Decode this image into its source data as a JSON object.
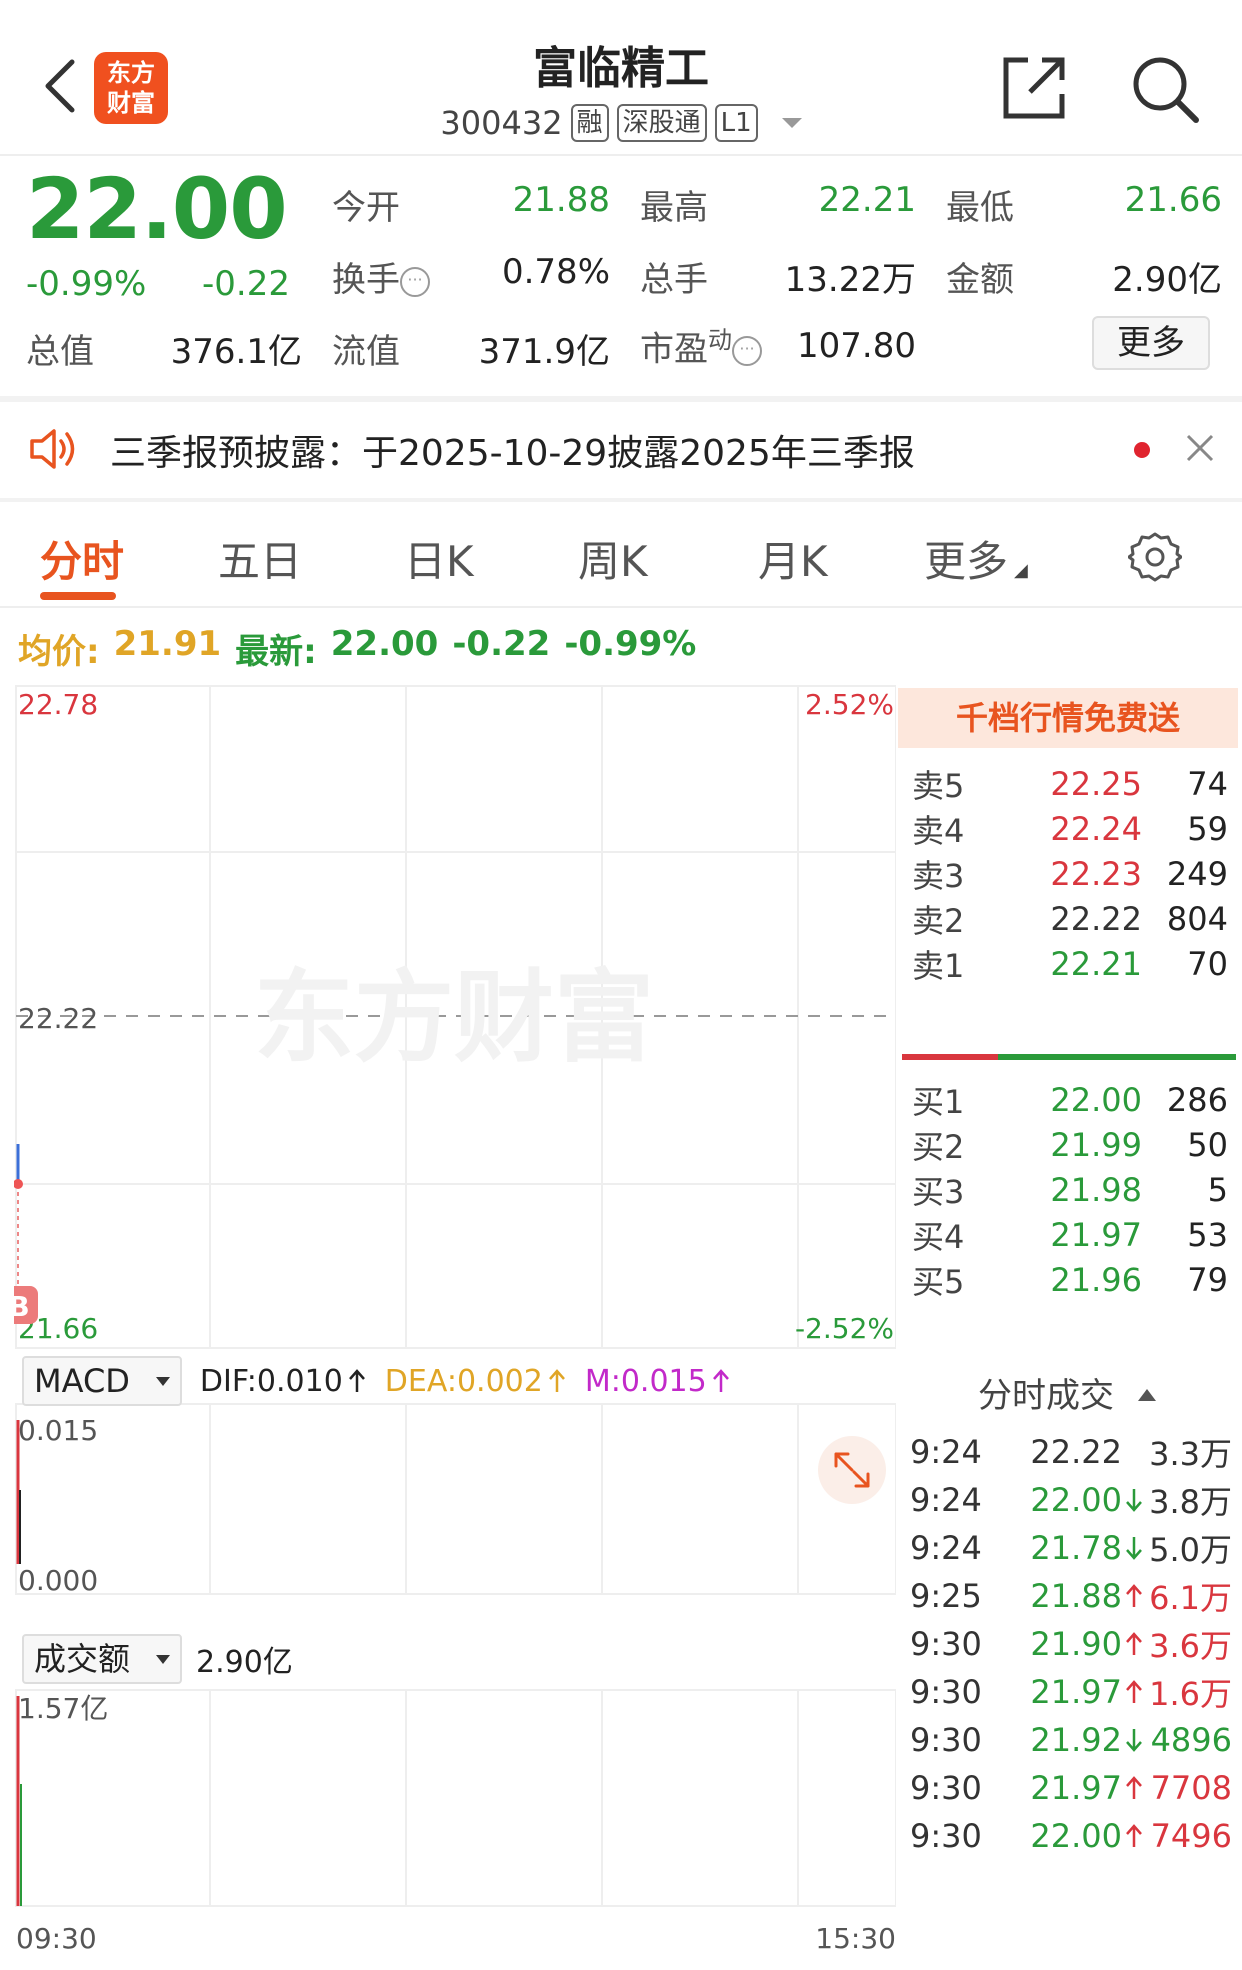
{
  "header": {
    "logo_text_line1": "东方",
    "logo_text_line2": "财富",
    "stock_name": "富临精工",
    "stock_code": "300432",
    "tags": [
      "融",
      "深股通",
      "L1"
    ]
  },
  "quote": {
    "price": "22.00",
    "change_pct": "-0.99%",
    "change": "-0.22",
    "fields": {
      "open_label": "今开",
      "open": "21.88",
      "high_label": "最高",
      "high": "22.21",
      "low_label": "最低",
      "low": "21.66",
      "turnover_label": "换手",
      "turnover": "0.78%",
      "volume_label": "总手",
      "volume": "13.22万",
      "amount_label": "金额",
      "amount": "2.90亿",
      "mktcap_label": "总值",
      "mktcap": "376.1亿",
      "float_label": "流值",
      "float": "371.9亿",
      "pe_label": "市盈",
      "pe_sup": "动",
      "pe": "107.80"
    },
    "more_label": "更多"
  },
  "notice": {
    "text": "三季报预披露：于2025-10-29披露2025年三季报"
  },
  "tabs": [
    "分时",
    "五日",
    "日K",
    "周K",
    "月K",
    "更多"
  ],
  "summary": {
    "avg_label": "均价:",
    "avg": "21.91",
    "latest_label": "最新:",
    "latest": "22.00",
    "change": "-0.22",
    "change_pct": "-0.99%"
  },
  "chart": {
    "price_high": "22.78",
    "price_mid": "22.22",
    "price_low": "21.66",
    "pct_high": "2.52%",
    "pct_low": "-2.52%",
    "watermark": "东方财富",
    "marker": "B",
    "macd": {
      "name": "MACD",
      "dif": "DIF:0.010",
      "dea": "DEA:0.002",
      "m": "M:0.015",
      "y_top": "0.015",
      "y_zero": "0.000"
    },
    "amount": {
      "name": "成交额",
      "value": "2.90亿",
      "y_top": "1.57亿"
    },
    "time_start": "09:30",
    "time_end": "15:30",
    "colors": {
      "up": "#d9363e",
      "down": "#2a9a3a",
      "avg": "#e0a526",
      "macd_m": "#c229c9"
    }
  },
  "orderbook": {
    "banner": "千档行情免费送",
    "asks": [
      {
        "label": "卖5",
        "price": "22.25",
        "vol": "74",
        "color": "red"
      },
      {
        "label": "卖4",
        "price": "22.24",
        "vol": "59",
        "color": "red"
      },
      {
        "label": "卖3",
        "price": "22.23",
        "vol": "249",
        "color": "red"
      },
      {
        "label": "卖2",
        "price": "22.22",
        "vol": "804",
        "color": "gray"
      },
      {
        "label": "卖1",
        "price": "22.21",
        "vol": "70",
        "color": "green"
      }
    ],
    "bids": [
      {
        "label": "买1",
        "price": "22.00",
        "vol": "286",
        "color": "green"
      },
      {
        "label": "买2",
        "price": "21.99",
        "vol": "50",
        "color": "green"
      },
      {
        "label": "买3",
        "price": "21.98",
        "vol": "5",
        "color": "green"
      },
      {
        "label": "买4",
        "price": "21.97",
        "vol": "53",
        "color": "green"
      },
      {
        "label": "买5",
        "price": "21.96",
        "vol": "79",
        "color": "green"
      }
    ]
  },
  "ticks": {
    "title": "分时成交",
    "rows": [
      {
        "time": "9:24",
        "price": "22.22",
        "dir": "",
        "vol": "3.3万",
        "pcolor": "gray",
        "vcolor": "gray"
      },
      {
        "time": "9:24",
        "price": "22.00",
        "dir": "down",
        "vol": "3.8万",
        "pcolor": "green",
        "vcolor": "gray"
      },
      {
        "time": "9:24",
        "price": "21.78",
        "dir": "down",
        "vol": "5.0万",
        "pcolor": "green",
        "vcolor": "gray"
      },
      {
        "time": "9:25",
        "price": "21.88",
        "dir": "up",
        "vol": "6.1万",
        "pcolor": "green",
        "vcolor": "red"
      },
      {
        "time": "9:30",
        "price": "21.90",
        "dir": "up",
        "vol": "3.6万",
        "pcolor": "green",
        "vcolor": "red"
      },
      {
        "time": "9:30",
        "price": "21.97",
        "dir": "up",
        "vol": "1.6万",
        "pcolor": "green",
        "vcolor": "red"
      },
      {
        "time": "9:30",
        "price": "21.92",
        "dir": "down",
        "vol": "4896",
        "pcolor": "green",
        "vcolor": "green"
      },
      {
        "time": "9:30",
        "price": "21.97",
        "dir": "up",
        "vol": "7708",
        "pcolor": "green",
        "vcolor": "red"
      },
      {
        "time": "9:30",
        "price": "22.00",
        "dir": "up",
        "vol": "7496",
        "pcolor": "green",
        "vcolor": "red"
      }
    ]
  }
}
